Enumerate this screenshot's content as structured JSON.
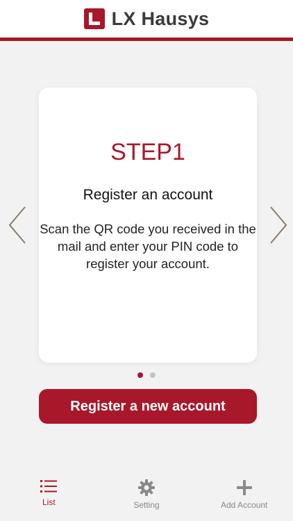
{
  "header": {
    "brand_name": "LX Hausys",
    "brand_color": "#a8182a"
  },
  "carousel": {
    "step_title": "STEP1",
    "heading": "Register an account",
    "description": "Scan the QR code you received in the mail and enter your PIN code to register your account.",
    "page_count": 2,
    "active_page": 1
  },
  "cta": {
    "label": "Register a new account"
  },
  "tabbar": {
    "tabs": [
      {
        "label": "List",
        "icon": "list-icon",
        "active": true
      },
      {
        "label": "Setting",
        "icon": "gear-icon",
        "active": false
      },
      {
        "label": "Add Account",
        "icon": "plus-icon",
        "active": false
      }
    ]
  },
  "colors": {
    "accent": "#a8182a",
    "inactive": "#888888",
    "background": "#f2f2f2"
  }
}
